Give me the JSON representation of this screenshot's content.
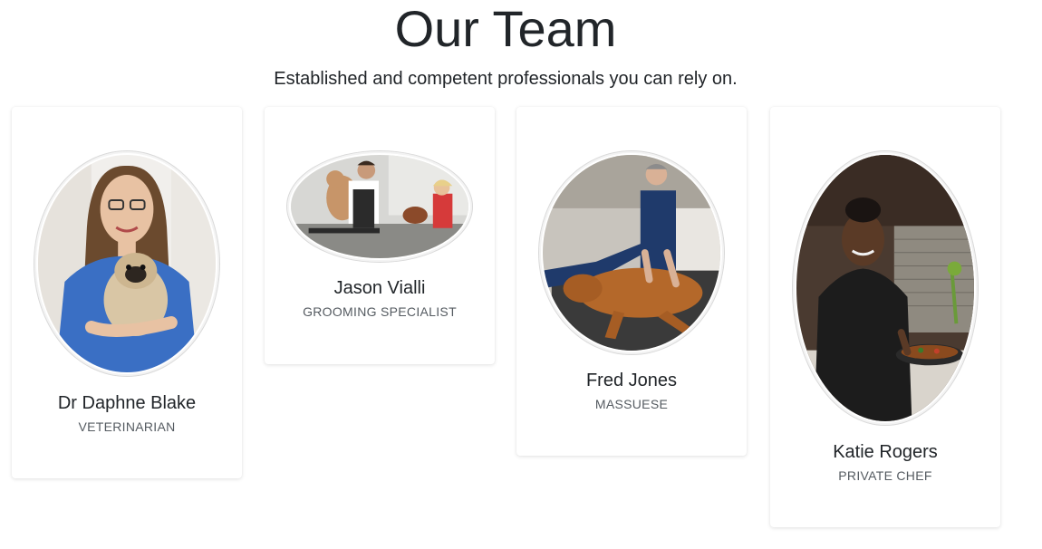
{
  "header": {
    "title": "Our Team",
    "subtitle": "Established and competent professionals you can rely on."
  },
  "team": [
    {
      "name": "Dr Daphne Blake",
      "role": "VETERINARIAN",
      "photo": "vet-with-pug-photo"
    },
    {
      "name": "Jason Vialli",
      "role": "GROOMING SPECIALIST",
      "photo": "groomers-with-poodles-photo"
    },
    {
      "name": "Fred Jones",
      "role": "MASSUESE",
      "photo": "massage-golden-retriever-photo"
    },
    {
      "name": "Katie Rogers",
      "role": "PRIVATE CHEF",
      "photo": "chef-in-kitchen-photo"
    }
  ],
  "colors": {
    "text": "#212529",
    "muted": "#555b61",
    "card_bg": "#ffffff",
    "vet_scrubs": "#3a6fc4",
    "massage_scrubs": "#1f3a6b",
    "golden_fur": "#b4682a",
    "chef_jacket": "#1c1c1c"
  }
}
